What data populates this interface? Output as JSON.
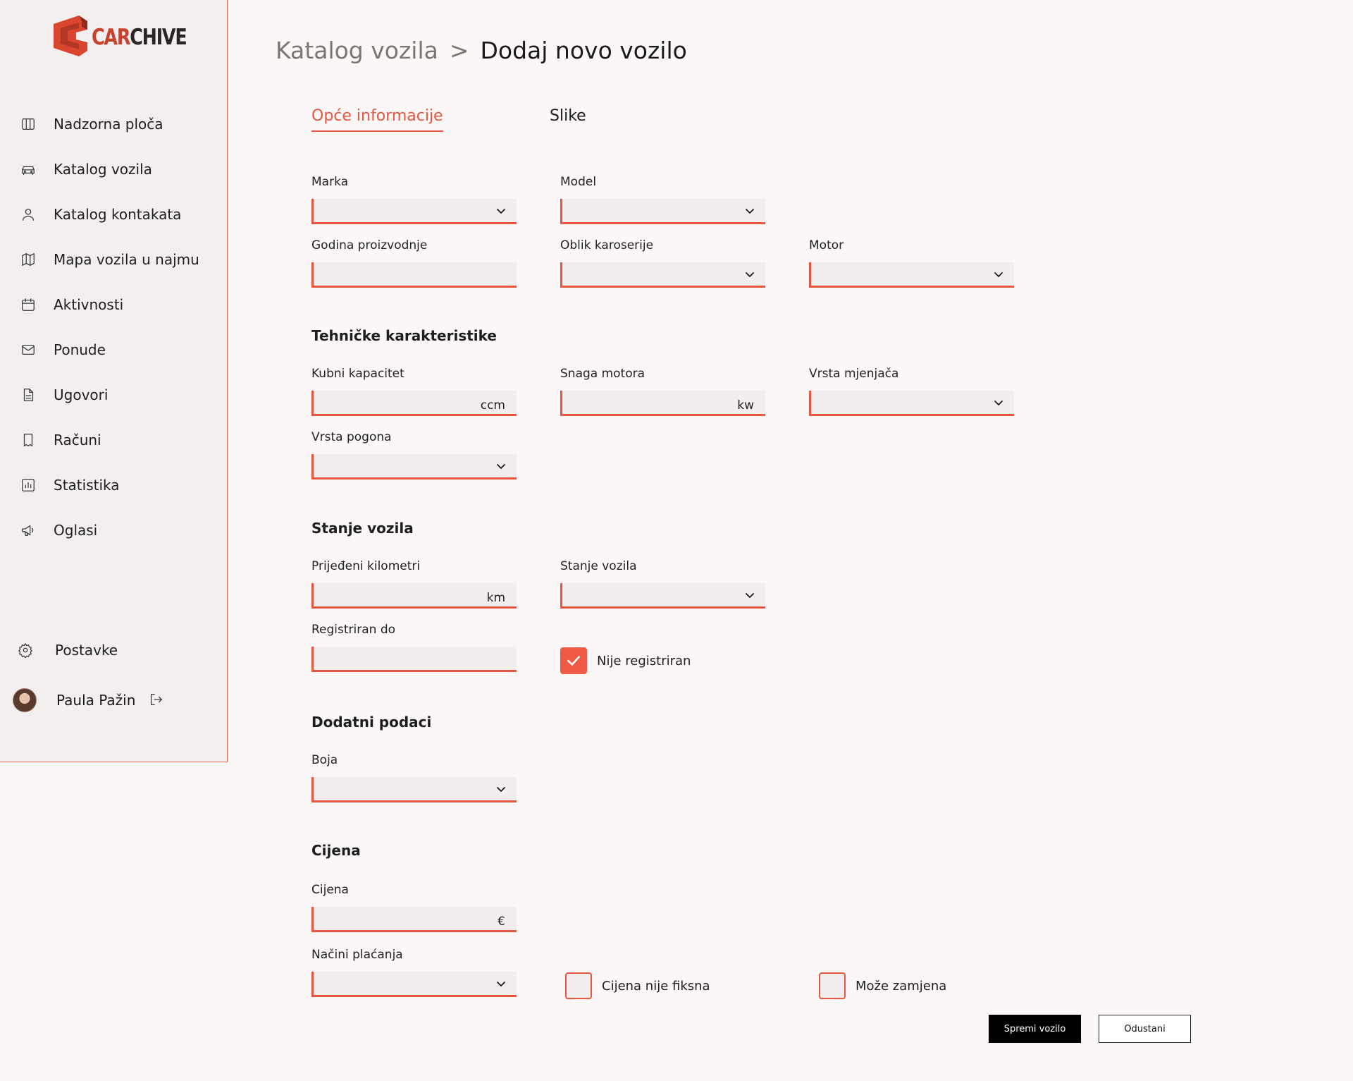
{
  "app": {
    "logo_text_accent": "CAR",
    "logo_text_rest": "CHIVE",
    "brand_color": "#e5573f"
  },
  "sidebar": {
    "items": [
      {
        "label": "Nadzorna ploča",
        "icon": "dashboard-icon"
      },
      {
        "label": "Katalog vozila",
        "icon": "car-icon"
      },
      {
        "label": "Katalog kontakata",
        "icon": "user-icon"
      },
      {
        "label": "Mapa vozila u najmu",
        "icon": "map-icon"
      },
      {
        "label": "Aktivnosti",
        "icon": "calendar-icon"
      },
      {
        "label": "Ponude",
        "icon": "mail-icon"
      },
      {
        "label": "Ugovori",
        "icon": "document-icon"
      },
      {
        "label": "Računi",
        "icon": "receipt-icon"
      },
      {
        "label": "Statistika",
        "icon": "chart-icon"
      },
      {
        "label": "Oglasi",
        "icon": "megaphone-icon"
      }
    ],
    "settings_label": "Postavke",
    "user_name": "Paula Pažin"
  },
  "breadcrumb": {
    "parent": "Katalog vozila",
    "separator": ">",
    "current": "Dodaj novo vozilo"
  },
  "tabs": {
    "general": "Opće informacije",
    "images": "Slike"
  },
  "sections": {
    "technical": "Tehničke karakteristike",
    "condition": "Stanje vozila",
    "additional": "Dodatni podaci",
    "price": "Cijena"
  },
  "fields": {
    "marka": {
      "label": "Marka",
      "value": ""
    },
    "model": {
      "label": "Model",
      "value": ""
    },
    "godina": {
      "label": "Godina proizvodnje",
      "value": ""
    },
    "oblik": {
      "label": "Oblik karoserije",
      "value": ""
    },
    "motor": {
      "label": "Motor",
      "value": ""
    },
    "kubni": {
      "label": "Kubni kapacitet",
      "unit": "ccm"
    },
    "snaga": {
      "label": "Snaga motora",
      "unit": "kw"
    },
    "mjenjac": {
      "label": "Vrsta mjenjača",
      "value": ""
    },
    "pogon": {
      "label": "Vrsta pogona",
      "value": ""
    },
    "kilometri": {
      "label": "Prijeđeni kilometri",
      "unit": "km"
    },
    "stanje": {
      "label": "Stanje vozila",
      "value": ""
    },
    "registriran": {
      "label": "Registriran do",
      "value": ""
    },
    "boja": {
      "label": "Boja",
      "value": ""
    },
    "cijena": {
      "label": "Cijena",
      "unit": "€"
    },
    "placanje": {
      "label": "Načini plaćanja",
      "value": ""
    }
  },
  "checkboxes": {
    "nije_registriran": {
      "label": "Nije registriran",
      "checked": true
    },
    "cijena_nije_fiksna": {
      "label": "Cijena nije fiksna",
      "checked": false
    },
    "moze_zamjena": {
      "label": "Može zamjena",
      "checked": false
    }
  },
  "buttons": {
    "save": "Spremi vozilo",
    "cancel": "Odustani"
  }
}
